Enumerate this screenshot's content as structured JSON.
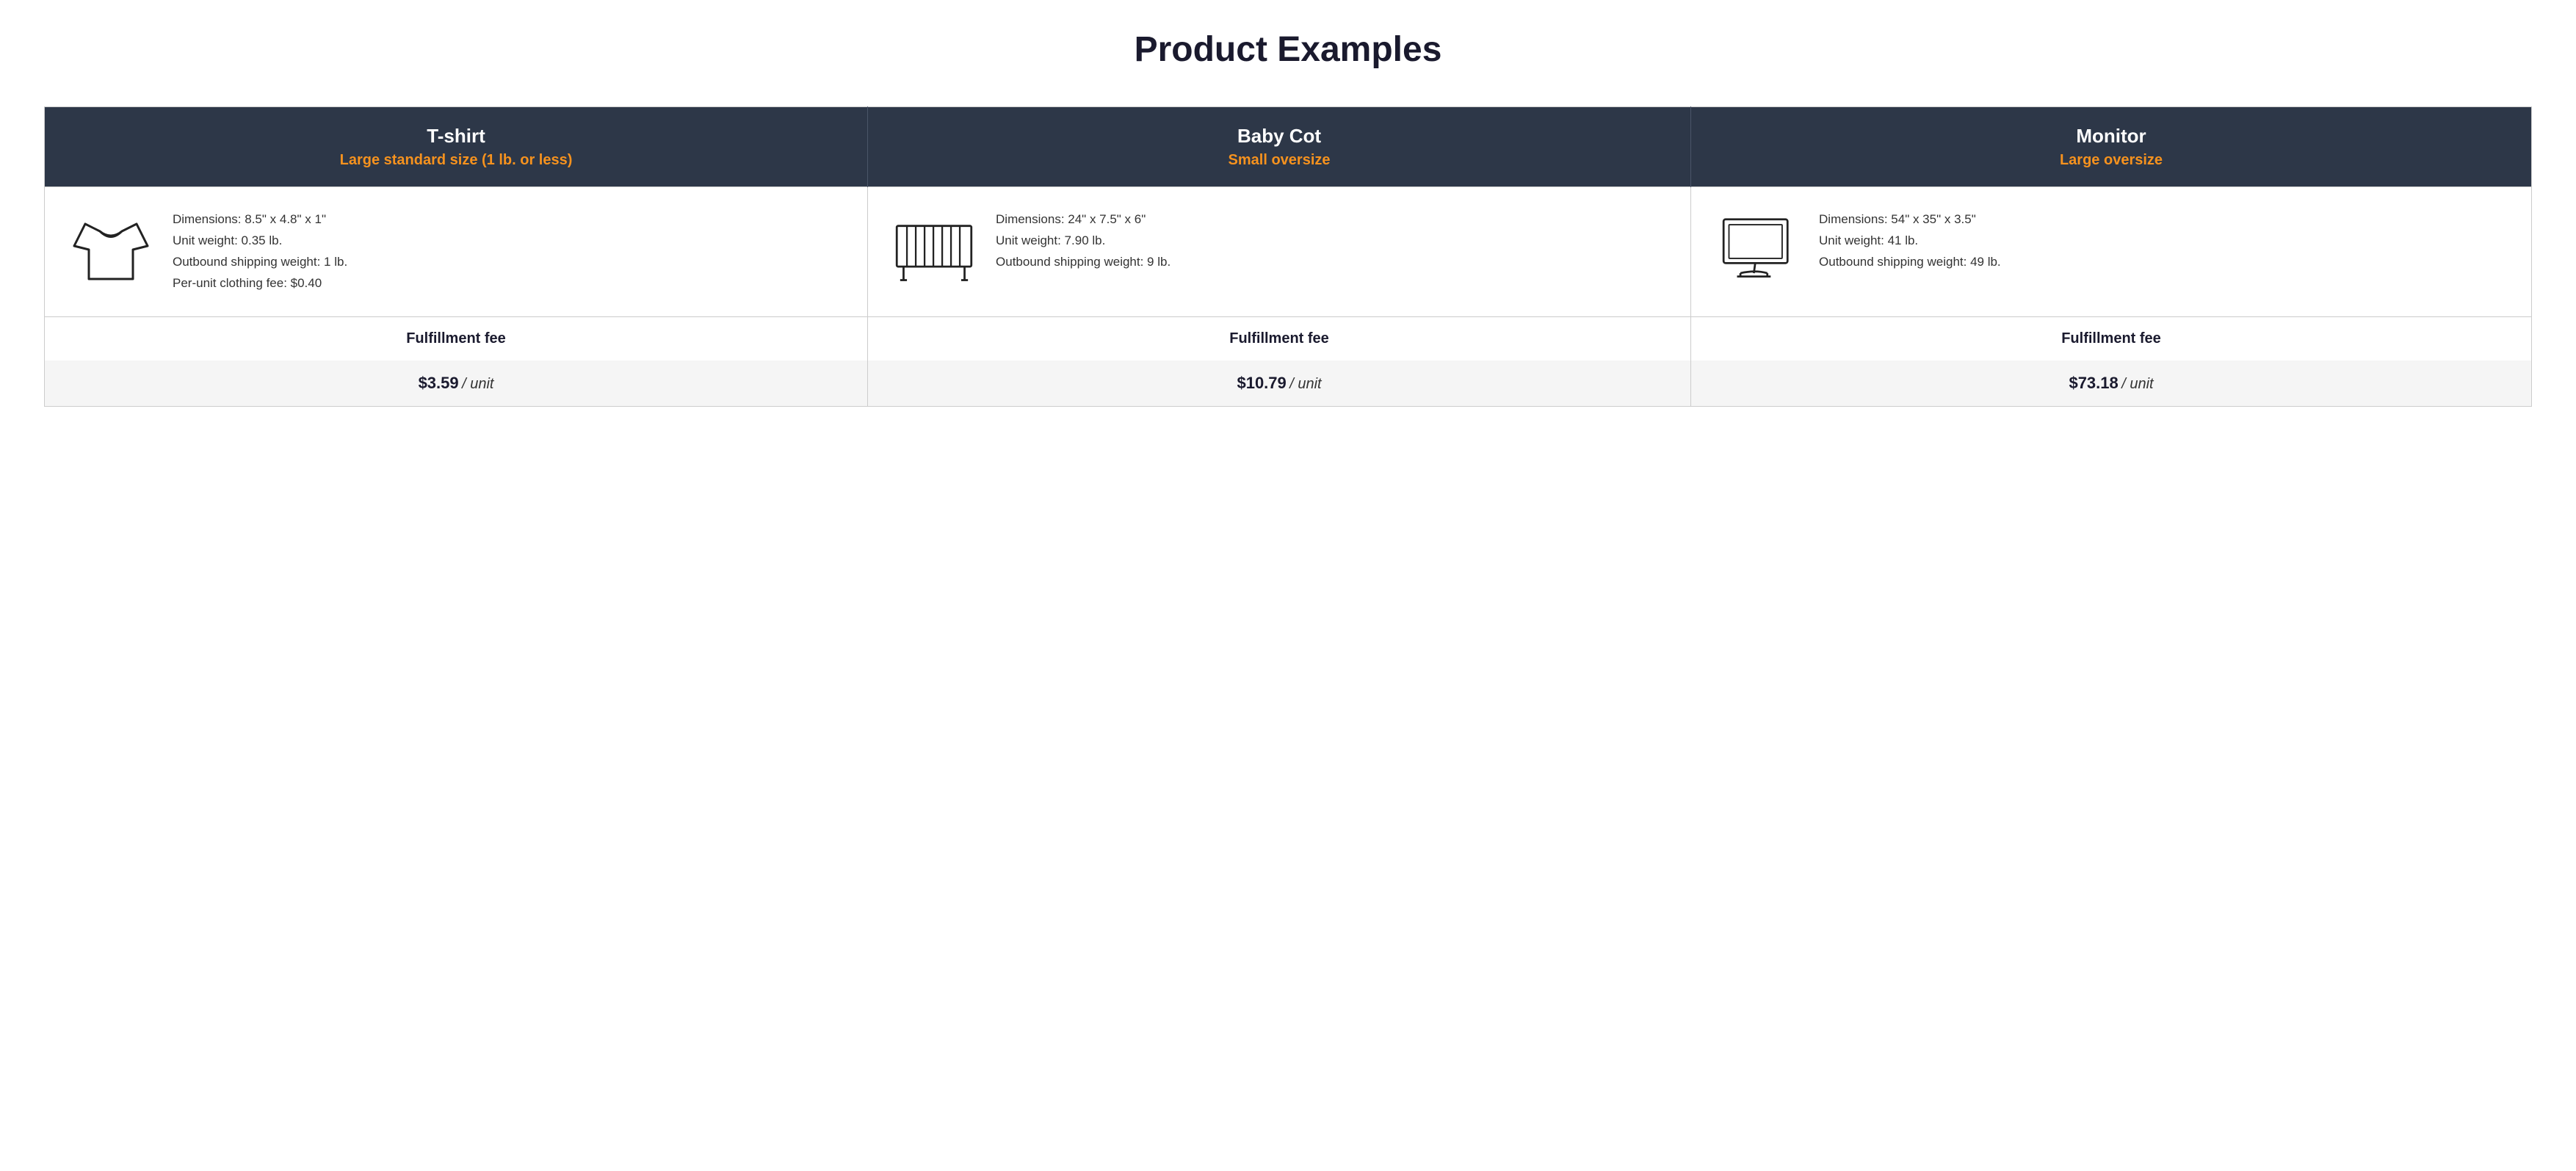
{
  "page": {
    "title": "Product Examples"
  },
  "products": [
    {
      "id": "tshirt",
      "name": "T-shirt",
      "size_label": "Large standard size (1 lb. or less)",
      "dimensions": "Dimensions: 8.5\" x 4.8\" x 1\"",
      "unit_weight": "Unit weight: 0.35 lb.",
      "outbound_shipping_weight": "Outbound shipping weight: 1 lb.",
      "extra_fee": "Per-unit clothing fee: $0.40",
      "fulfillment_label": "Fulfillment fee",
      "price": "$3.59",
      "price_unit": "/ unit"
    },
    {
      "id": "babycot",
      "name": "Baby Cot",
      "size_label": "Small oversize",
      "dimensions": "Dimensions: 24\" x 7.5\" x 6\"",
      "unit_weight": "Unit weight: 7.90 lb.",
      "outbound_shipping_weight": "Outbound shipping weight: 9 lb.",
      "extra_fee": "",
      "fulfillment_label": "Fulfillment fee",
      "price": "$10.79",
      "price_unit": "/ unit"
    },
    {
      "id": "monitor",
      "name": "Monitor",
      "size_label": "Large oversize",
      "dimensions": "Dimensions: 54\" x 35\" x 3.5\"",
      "unit_weight": "Unit weight: 41 lb.",
      "outbound_shipping_weight": "Outbound shipping weight: 49 lb.",
      "extra_fee": "",
      "fulfillment_label": "Fulfillment fee",
      "price": "$73.18",
      "price_unit": "/ unit"
    }
  ]
}
